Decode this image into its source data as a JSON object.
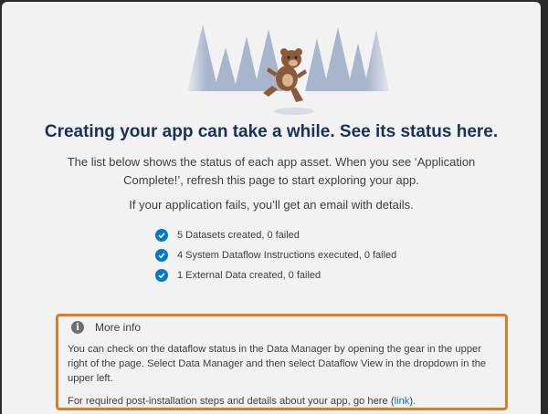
{
  "headline": "Creating your app can take a while. See its status here.",
  "description": "The list below shows the status of each app asset. When you see ‘Application Complete!’, refresh this page to start exploring your app.",
  "fail_note": "If your application fails, you’ll get an email with details.",
  "status_items": [
    {
      "label": "5 Datasets created, 0 failed",
      "icon": "check-icon"
    },
    {
      "label": "4 System Dataflow Instructions executed, 0 failed",
      "icon": "check-icon"
    },
    {
      "label": "1 External Data created, 0 failed",
      "icon": "check-icon"
    }
  ],
  "info": {
    "icon_glyph": "i",
    "title": "More info",
    "body": "You can check on the dataflow status in the Data Manager by opening the gear in the upper right of the page. Select Data Manager and then select Dataflow View in the dropdown in the upper left.",
    "footer_text": "For required post-installation steps and details about your app, go here (",
    "footer_link": "link",
    "footer_end": ")."
  },
  "colors": {
    "headline": "#16325c",
    "check": "#0176d3",
    "highlight_border": "#e07b22",
    "trees": "#a7b6cc",
    "bear": "#8a5a3b"
  }
}
